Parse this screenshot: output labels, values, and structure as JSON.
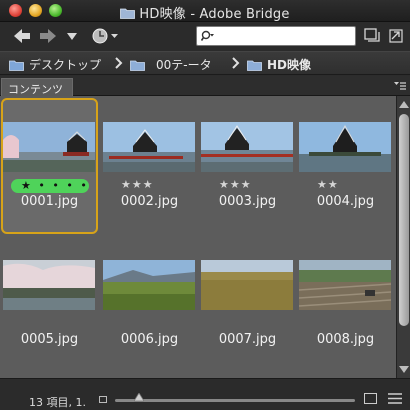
{
  "window": {
    "title": "HD映像 - Adobe Bridge"
  },
  "toolbar": {
    "search_value": "",
    "search_placeholder": ""
  },
  "breadcrumb": {
    "items": [
      {
        "label": "デスクトップ"
      },
      {
        "label": "00テ-ータ"
      },
      {
        "label": "HD映像"
      }
    ]
  },
  "panel": {
    "tab_label": "コンテンツ"
  },
  "thumbnails": [
    {
      "filename": "0001.jpg",
      "stars": "★ • • • •",
      "selected": true
    },
    {
      "filename": "0002.jpg",
      "stars": "★★★",
      "selected": false
    },
    {
      "filename": "0003.jpg",
      "stars": "★★★",
      "selected": false
    },
    {
      "filename": "0004.jpg",
      "stars": "★★",
      "selected": false
    },
    {
      "filename": "0005.jpg",
      "stars": "",
      "selected": false
    },
    {
      "filename": "0006.jpg",
      "stars": "",
      "selected": false
    },
    {
      "filename": "0007.jpg",
      "stars": "",
      "selected": false
    },
    {
      "filename": "0008.jpg",
      "stars": "",
      "selected": false
    }
  ],
  "status": {
    "text": "13 項目, 1.",
    "zoom_fraction": 0.1
  },
  "colors": {
    "selection_border": "#d7a319",
    "label_green": "#4fd35a",
    "content_bg": "#5c5c5c"
  },
  "icons": [
    "back-arrow-icon",
    "forward-arrow-icon",
    "dropdown-icon",
    "recent-icon",
    "search-icon",
    "new-window-icon",
    "compact-mode-icon",
    "folder-icon",
    "breadcrumb-separator-icon",
    "panel-menu-icon"
  ]
}
